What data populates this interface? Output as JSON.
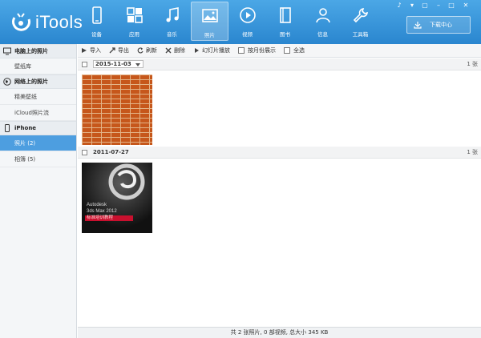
{
  "app": {
    "logo_text": "iTools"
  },
  "nav": [
    {
      "label": "设备",
      "icon": "phone-icon"
    },
    {
      "label": "应用",
      "icon": "apps-icon"
    },
    {
      "label": "音乐",
      "icon": "music-icon"
    },
    {
      "label": "照片",
      "icon": "photo-icon",
      "active": true
    },
    {
      "label": "视频",
      "icon": "video-icon"
    },
    {
      "label": "图书",
      "icon": "book-icon"
    },
    {
      "label": "信息",
      "icon": "person-icon"
    },
    {
      "label": "工具箱",
      "icon": "wrench-icon"
    }
  ],
  "download_center": {
    "label": "下载中心"
  },
  "sidebar": {
    "groups": [
      {
        "title": "电脑上的照片",
        "icon": "monitor-icon",
        "items": [
          {
            "label": "壁纸库"
          }
        ]
      },
      {
        "title": "网络上的照片",
        "icon": "globe-icon",
        "items": [
          {
            "label": "精美壁纸"
          },
          {
            "label": "iCloud照片流"
          }
        ]
      },
      {
        "title": "iPhone",
        "icon": "iphone-icon",
        "items": [
          {
            "label": "照片 (2)",
            "active": true
          },
          {
            "label": "相簿 (5)"
          }
        ]
      }
    ]
  },
  "toolbar": {
    "import": "导入",
    "export": "导出",
    "refresh": "刷新",
    "delete": "删除",
    "slideshow": "幻灯片播放",
    "by_month": "按月份展示",
    "select_all": "全选"
  },
  "groups": [
    {
      "date": "2015-11-03",
      "count": "1 张"
    },
    {
      "date": "2011-07-27",
      "count": "1 张"
    }
  ],
  "book_cover": {
    "line1": "Autodesk",
    "line2": "3ds Max 2012",
    "line3": "标准培训教程"
  },
  "status": "共 2 张照片, 0 部视频, 总大小 345 KB",
  "colors": {
    "header": "#2a86cf",
    "active": "#4d9ee0"
  }
}
